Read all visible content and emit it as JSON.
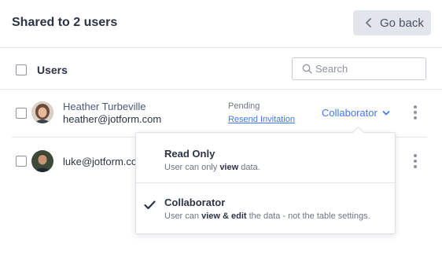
{
  "header": {
    "title": "Shared to 2 users",
    "go_back_label": "Go back"
  },
  "table": {
    "users_label": "Users",
    "search_placeholder": "Search"
  },
  "users": [
    {
      "name": "Heather Turbeville",
      "email": "heather@jotform.com",
      "status": "Pending",
      "resend_label": "Resend Invitation",
      "role": "Collaborator"
    },
    {
      "email": "luke@jotform.com"
    }
  ],
  "role_menu": {
    "options": [
      {
        "title": "Read Only",
        "desc_pre": "User can only ",
        "desc_bold": "view",
        "desc_post": " data.",
        "selected": false
      },
      {
        "title": "Collaborator",
        "desc_pre": "User can ",
        "desc_bold": "view & edit",
        "desc_post": " the data - not the table settings.",
        "selected": true
      }
    ]
  },
  "colors": {
    "accent": "#4277f4",
    "text": "#2c3345",
    "muted": "#6f7585",
    "border": "#e3e5ec"
  },
  "icons": {
    "go_back": "chevron-left-icon",
    "search": "search-icon",
    "role_dropdown": "chevron-down-icon",
    "more": "more-vertical-icon",
    "selected": "check-icon"
  }
}
